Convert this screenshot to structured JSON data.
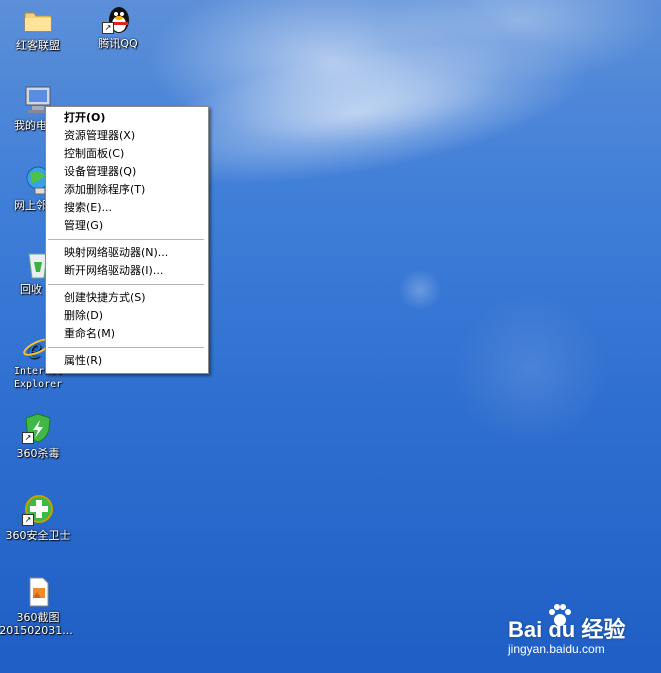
{
  "desktop": {
    "icons": [
      {
        "label": "红客联盟",
        "label2": ""
      },
      {
        "label": "腾讯QQ",
        "label2": ""
      },
      {
        "label": "我的电",
        "label2": ""
      },
      {
        "label": "网上邻",
        "label2": ""
      },
      {
        "label": "回收",
        "label2": ""
      },
      {
        "label": "Internet",
        "label2": "Explorer"
      },
      {
        "label": "360杀毒",
        "label2": ""
      },
      {
        "label": "360安全卫士",
        "label2": ""
      },
      {
        "label": "360截图",
        "label2": "201502031..."
      }
    ]
  },
  "context_menu": {
    "items": [
      {
        "label": "打开(O)"
      },
      {
        "label": "资源管理器(X)"
      },
      {
        "label": "控制面板(C)"
      },
      {
        "label": "设备管理器(Q)"
      },
      {
        "label": "添加删除程序(T)"
      },
      {
        "label": "搜索(E)..."
      },
      {
        "label": "管理(G)"
      },
      {
        "label": "映射网络驱动器(N)..."
      },
      {
        "label": "断开网络驱动器(I)..."
      },
      {
        "label": "创建快捷方式(S)"
      },
      {
        "label": "删除(D)"
      },
      {
        "label": "重命名(M)"
      },
      {
        "label": "属性(R)"
      }
    ]
  },
  "watermark": {
    "logo": "Bai du 经验",
    "site": "jingyan.baidu.com"
  },
  "colors": {
    "desktop_blue": "#2f6fd0",
    "menu_bg": "#ffffff"
  }
}
